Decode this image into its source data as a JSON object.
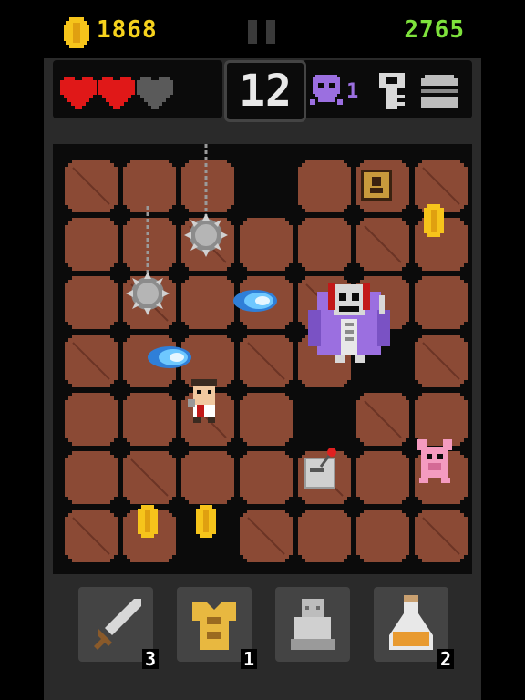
{
  "top_bar": {
    "gold": "1868",
    "score": "2765"
  },
  "hud": {
    "hearts": [
      "full",
      "full",
      "empty"
    ],
    "floor": "12",
    "kills": "1",
    "icons": {
      "kill": "skull-icon",
      "key": "key-icon",
      "food": "burger-icon"
    }
  },
  "inventory": [
    {
      "name": "sword",
      "icon": "sword-icon",
      "count": "3"
    },
    {
      "name": "armor",
      "icon": "golden-armor-icon",
      "count": "1"
    },
    {
      "name": "statue",
      "icon": "stone-statue-icon",
      "count": ""
    },
    {
      "name": "potion",
      "icon": "potion-flask-icon",
      "count": "2"
    }
  ],
  "colors": {
    "gold": "#f6d21d",
    "score": "#7ee23c",
    "tile": "#8b4a35",
    "tile_dark": "#6b3425",
    "fireball": "#6ec8ff",
    "reaper": "#9b6fe0"
  }
}
